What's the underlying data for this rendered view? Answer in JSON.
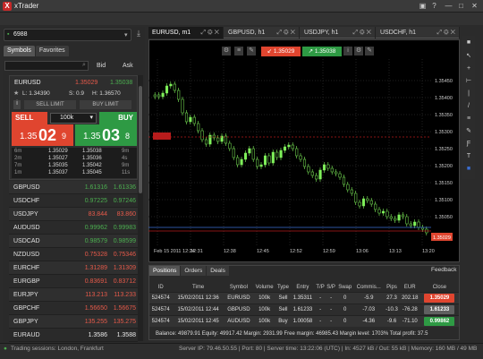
{
  "app": {
    "title": "xTrader",
    "logo": "X",
    "win_buttons": [
      "▣",
      "?",
      "—",
      "□",
      "✕"
    ]
  },
  "account": {
    "number": "6988"
  },
  "left_tabs": [
    "Symbols",
    "Favorites"
  ],
  "col_headers": {
    "bid": "Bid",
    "ask": "Ask"
  },
  "card": {
    "symbol": "EURUSD",
    "bid": "1.35029",
    "ask": "1.35038",
    "low": "L: 1.34390",
    "spread": "S: 0.9",
    "high": "H: 1.36570",
    "sell_limit": "SELL LIMIT",
    "buy_limit": "BUY LIMIT",
    "sell": "SELL",
    "buy": "BUY",
    "qty": "100k",
    "sell_big": "1.35",
    "sell_pip": "02",
    "sell_frac": "9",
    "buy_big": "1.35",
    "buy_pip": "03",
    "buy_frac": "8",
    "ticks": [
      [
        "6m",
        "1.35029",
        "1.35038",
        "9m"
      ],
      [
        "2m",
        "1.35027",
        "1.35036",
        "4s"
      ],
      [
        "7m",
        "1.35035",
        "1.35042",
        "9m"
      ],
      [
        "1m",
        "1.35037",
        "1.35045",
        "11s"
      ]
    ]
  },
  "symbols": [
    {
      "name": "GBPUSD",
      "bid": "1.61316",
      "ask": "1.61336",
      "color": "up"
    },
    {
      "name": "USDCHF",
      "bid": "0.97225",
      "ask": "0.97246",
      "color": "up"
    },
    {
      "name": "USDJPY",
      "bid": "83.844",
      "ask": "83.860",
      "color": "dn"
    },
    {
      "name": "AUDUSD",
      "bid": "0.99962",
      "ask": "0.99983",
      "color": "up"
    },
    {
      "name": "USDCAD",
      "bid": "0.98579",
      "ask": "0.98599",
      "color": "up"
    },
    {
      "name": "NZDUSD",
      "bid": "0.75328",
      "ask": "0.75346",
      "color": "dn"
    },
    {
      "name": "EURCHF",
      "bid": "1.31289",
      "ask": "1.31309",
      "color": "dn"
    },
    {
      "name": "EURGBP",
      "bid": "0.83691",
      "ask": "0.83712",
      "color": "dn"
    },
    {
      "name": "EURJPY",
      "bid": "113.213",
      "ask": "113.233",
      "color": "dn"
    },
    {
      "name": "GBPCHF",
      "bid": "1.56650",
      "ask": "1.56675",
      "color": "dn"
    },
    {
      "name": "GBPJPY",
      "bid": "135.255",
      "ask": "135.275",
      "color": "dn"
    },
    {
      "name": "EURAUD",
      "bid": "1.3586",
      "ask": "1.3588",
      "color": "wh"
    }
  ],
  "chart_tabs": [
    "EURUSD, m1",
    "GBPUSD, h1",
    "USDJPY, h1",
    "USDCHF, h1"
  ],
  "chart": {
    "sell": "1.35029",
    "buy": "1.35038",
    "price_labels": [
      "1.35450",
      "1.35400",
      "1.35350",
      "1.35300",
      "1.35250",
      "1.35200",
      "1.35150",
      "1.35100",
      "1.35050"
    ],
    "time_labels": [
      "Feb 15 2011 12:24",
      "12:31",
      "12:38",
      "12:45",
      "12:52",
      "12:59",
      "13:06",
      "13:13",
      "13:20"
    ],
    "marker_left": "1.35xxx",
    "current": "1.35029"
  },
  "bottom_tabs": [
    "Positions",
    "Orders",
    "Deals"
  ],
  "feedback": "Feedback",
  "columns": [
    "ID",
    "Time",
    "Symbol",
    "Volume",
    "Type",
    "Entry",
    "T/P",
    "S/P",
    "Swap",
    "Commis...",
    "Pips",
    "EUR",
    "Close"
  ],
  "positions": [
    [
      "524574",
      "15/02/2011 12:36",
      "EURUSD",
      "100k",
      "Sell",
      "1.35311",
      "-",
      "-",
      "0",
      "-5.9",
      "27.3",
      "202.18",
      "1.35029"
    ],
    [
      "524574",
      "15/02/2011 12:44",
      "GBPUSD",
      "100k",
      "Sell",
      "1.61233",
      "-",
      "-",
      "0",
      "-7.03",
      "-10.3",
      "-76.28",
      "1.61233"
    ],
    [
      "524574",
      "15/02/2011 12:45",
      "AUDUSD",
      "100k",
      "Buy",
      "1.00058",
      "-",
      "-",
      "0",
      "-4.36",
      "-9.6",
      "-71.10",
      "0.99862"
    ]
  ],
  "close_colors": [
    "#e0452f",
    "#606060",
    "#2e9a44"
  ],
  "summary": "Balance: 49879.91   Equity: 49917.42   Margin: 2931.99   Free margin: 46985.43   Margin level: 1703%   Total profit: 37.5",
  "status": {
    "left": "Trading sessions: London, Frankfurt",
    "right": "Server IP: 79.46.50.55 | Port: 80 | Server time: 13:22:06 (UTC) | In: 4527 kB / Out: 55 kB | Memory: 160 MB / 49 MB"
  }
}
